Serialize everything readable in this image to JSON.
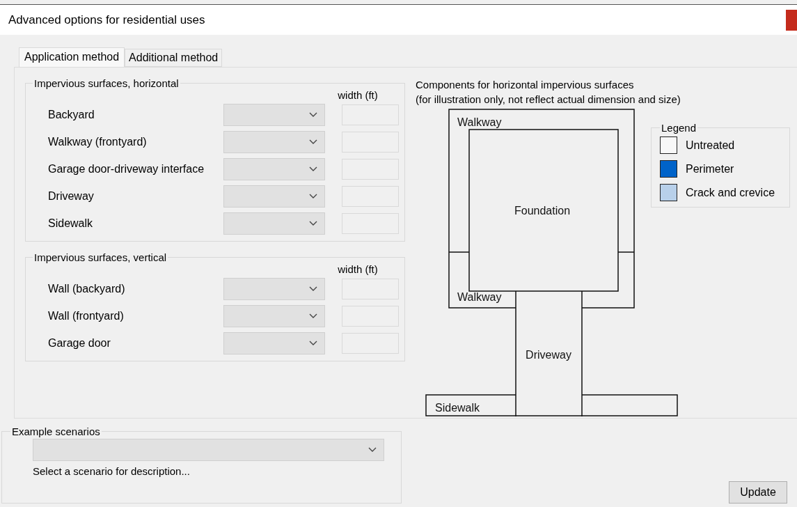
{
  "window": {
    "title": "Advanced options for residential uses"
  },
  "tabs": [
    {
      "label": "Application method",
      "selected": true
    },
    {
      "label": "Additional method",
      "selected": false
    }
  ],
  "groups": [
    {
      "title": "Impervious surfaces, horizontal",
      "column_header": "width (ft)",
      "rows": [
        {
          "label": "Backyard"
        },
        {
          "label": "Walkway (frontyard)"
        },
        {
          "label": "Garage door-driveway interface"
        },
        {
          "label": "Driveway"
        },
        {
          "label": "Sidewalk"
        }
      ]
    },
    {
      "title": "Impervious surfaces, vertical",
      "column_header": "width (ft)",
      "rows": [
        {
          "label": "Wall (backyard)"
        },
        {
          "label": "Wall (frontyard)"
        },
        {
          "label": "Garage door"
        }
      ]
    }
  ],
  "diagram": {
    "title": "Components for horizontal impervious surfaces",
    "subtitle": "(for illustration only, not reflect actual dimension and size)",
    "areas": {
      "walkway_top": "Walkway",
      "foundation": "Foundation",
      "walkway_bottom": "Walkway",
      "driveway": "Driveway",
      "sidewalk": "Sidewalk"
    },
    "legend": {
      "title": "Legend",
      "items": [
        {
          "label": "Untreated",
          "color": "#f8f8f8"
        },
        {
          "label": "Perimeter",
          "color": "#0063c9"
        },
        {
          "label": "Crack and crevice",
          "color": "#b8d0ea"
        }
      ]
    }
  },
  "scenarios": {
    "title": "Example scenarios",
    "description": "Select a scenario for description..."
  },
  "buttons": [
    {
      "label": "Update"
    }
  ]
}
